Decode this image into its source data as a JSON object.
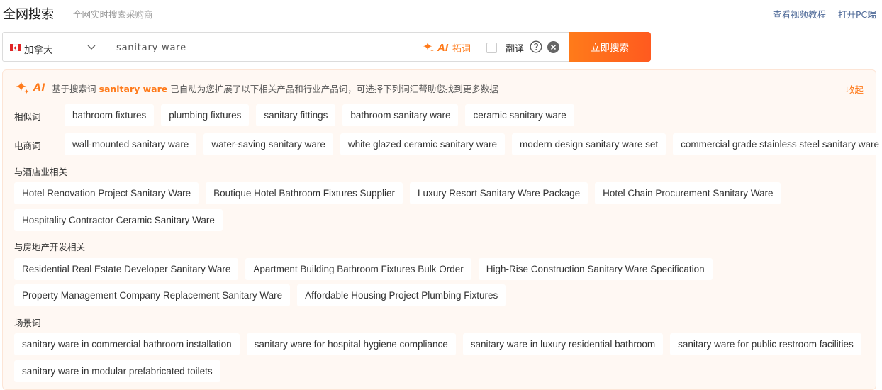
{
  "header": {
    "title": "全网搜索",
    "subtitle": "全网实时搜索采购商",
    "video_tutorial": "查看视频教程",
    "open_pc": "打开PC端"
  },
  "search": {
    "country": "加拿大",
    "flag_icon": "canada-flag-icon",
    "query": "sanitary ware",
    "ai_badge": "AI",
    "ai_expand_label": "拓词",
    "translate_label": "翻译",
    "search_button": "立即搜索"
  },
  "ai_panel": {
    "badge": "AI",
    "desc_prefix": "基于搜索词",
    "keyword": "sanitary ware",
    "desc_suffix": "已自动为您扩展了以下相关产品和行业产品词，可选择下列词汇帮助您找到更多数据",
    "collapse": "收起",
    "similar": {
      "label": "相似词",
      "tags": [
        "bathroom fixtures",
        "plumbing fixtures",
        "sanitary fittings",
        "bathroom sanitary ware",
        "ceramic sanitary ware"
      ]
    },
    "ecommerce": {
      "label": "电商词",
      "tags": [
        "wall-mounted sanitary ware",
        "water-saving sanitary ware",
        "white glazed ceramic sanitary ware",
        "modern design sanitary ware set",
        "commercial grade stainless steel sanitary ware"
      ]
    },
    "hotel": {
      "label": "与酒店业相关",
      "tags": [
        "Hotel Renovation Project Sanitary Ware",
        "Boutique Hotel Bathroom Fixtures Supplier",
        "Luxury Resort Sanitary Ware Package",
        "Hotel Chain Procurement Sanitary Ware",
        "Hospitality Contractor Ceramic Sanitary Ware"
      ]
    },
    "real_estate": {
      "label": "与房地产开发相关",
      "tags": [
        "Residential Real Estate Developer Sanitary Ware",
        "Apartment Building Bathroom Fixtures Bulk Order",
        "High-Rise Construction Sanitary Ware Specification",
        "Property Management Company Replacement Sanitary Ware",
        "Affordable Housing Project Plumbing Fixtures"
      ]
    },
    "scenario": {
      "label": "场景词",
      "tags": [
        "sanitary ware in commercial bathroom installation",
        "sanitary ware for hospital hygiene compliance",
        "sanitary ware in luxury residential bathroom",
        "sanitary ware for public restroom facilities",
        "sanitary ware in modular prefabricated toilets"
      ]
    }
  },
  "colors": {
    "accent": "#ff7a1a",
    "link": "#4f6a98",
    "panel_bg": "#fff8f3"
  }
}
